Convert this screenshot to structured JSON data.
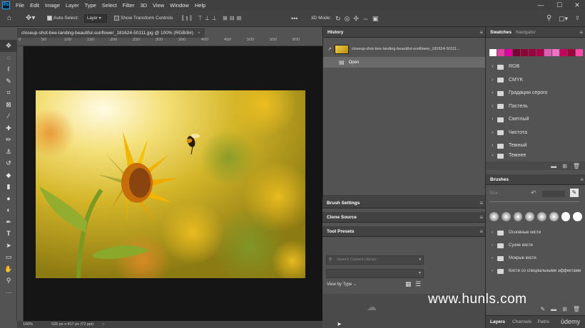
{
  "app": {
    "logo": "Ps"
  },
  "menu": [
    "File",
    "Edit",
    "Image",
    "Layer",
    "Type",
    "Select",
    "Filter",
    "3D",
    "View",
    "Window",
    "Help"
  ],
  "window_controls": {
    "minimize": "—",
    "maximize": "☐",
    "close": "✕"
  },
  "options": {
    "auto_select_label": "Auto-Select:",
    "auto_select_value": "Layer",
    "show_transform_label": "Show Transform Controls",
    "mode_3d_label": "3D Mode:",
    "more": "•••"
  },
  "document": {
    "tab_label": "closeup-shot-bee-landing-beautiful-sunflower_181624-50111.jpg @ 100% (RGB/8#)",
    "tab_close": "×",
    "zoom": "100%",
    "doc_info": "626 px x 417 px (72 ppi)",
    "status_arrow": ">"
  },
  "ruler_ticks": [
    "0",
    "50",
    "100",
    "150",
    "200",
    "250",
    "300",
    "350",
    "400",
    "450",
    "500",
    "550",
    "600"
  ],
  "history": {
    "title": "History",
    "snapshot_label": "closeup-shot-bee-landing-beautiful-sunflower_181624-50111...",
    "items": [
      {
        "label": "Open"
      }
    ]
  },
  "collapsed_panels": {
    "brush_settings": "Brush Settings",
    "clone_source": "Clone Source",
    "tool_presets": "Tool Presets"
  },
  "tool_presets": {
    "search_placeholder": "Search Current Library",
    "view_by": "View by Type"
  },
  "swatches": {
    "tab_active": "Swatches",
    "tab_other": "Navigator",
    "colors": [
      "#ffffff",
      "#e23fa4",
      "#e0009a",
      "#7a0035",
      "#8c0035",
      "#9b003e",
      "#ae0048",
      "#e05db8",
      "#f070c8",
      "#c7005a",
      "#a0003c",
      "#ff49a8"
    ],
    "folders": [
      "RGB",
      "CMYK",
      "Градации серого",
      "Пастель",
      "Светлый",
      "Чистота",
      "Темный",
      "Темнее"
    ]
  },
  "brushes": {
    "title": "Brushes",
    "size_label": "Size",
    "folders": [
      "Основные кисти",
      "Сухие кисти",
      "Мокрые кисти",
      "Кисти со специальными эффектами"
    ]
  },
  "bottom_tabs": [
    "Layers",
    "Channels",
    "Paths"
  ],
  "watermarks": {
    "hunls": "www.hunls.com",
    "udemy": "ūdemy"
  },
  "colors": {
    "accent": "#31a8ff",
    "canvas_bg": "#151515",
    "panel_bg": "#535353",
    "bar_bg": "#424242"
  }
}
